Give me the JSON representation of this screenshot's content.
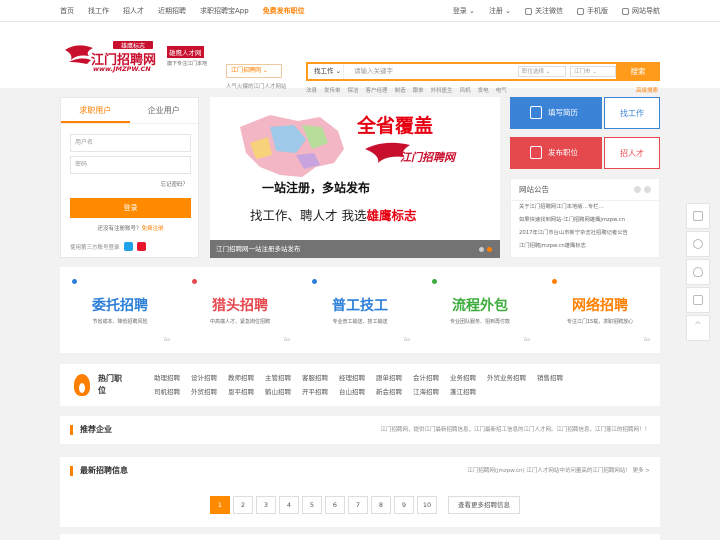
{
  "topnav": {
    "items": [
      "首页",
      "找工作",
      "招人才",
      "近期招聘",
      "求职招聘宝App"
    ],
    "highlight": "免费发布职位",
    "login": "登录 ⌄",
    "register": "注册 ⌄",
    "wechat": "关注微信",
    "mobile": "手机版",
    "sitenav": "网站导航"
  },
  "logo": {
    "main": "江门招聘网",
    "tag": "雄鹰标志",
    "url": "www.JMZPW.CN",
    "partner": "雄鹰人才网",
    "partner_sub": "旗下专注江门本地"
  },
  "city": {
    "name": "江门招聘网 ⌄",
    "sub": "人气火爆的江门人才网站"
  },
  "search": {
    "category": "找工作 ⌄",
    "placeholder": "请输入关键字",
    "select1": "职位选择 ⌄",
    "select2": "江门市 ⌄",
    "button": "搜索",
    "advanced": "高级搜索",
    "hot": [
      "法县",
      "发传单",
      "保洁",
      "客户经理",
      "制造",
      "跟单",
      "外科医生",
      "风机",
      "发电",
      "电气"
    ]
  },
  "login": {
    "tab_jobseeker": "求职用户",
    "tab_employer": "企业用户",
    "username_placeholder": "用户名",
    "password_placeholder": "密码",
    "forgot": "忘记密码？",
    "button": "登录",
    "register_text": "还没有注册账号？",
    "register_link": "免费注册",
    "third_party": "使用第三方账号登录"
  },
  "banner": {
    "title": "全省覆盖",
    "line1": "一站注册，多站发布",
    "line2_prefix": "找工作、聘人才 我选",
    "line2_brand": "雄鹰标志",
    "brand": "江门招聘网",
    "caption": "江门招聘网一站注册多站发布"
  },
  "quick": {
    "resume": "填写简历",
    "find_job": "找工作",
    "post_job": "发布职位",
    "hire": "招人才"
  },
  "notice": {
    "title": "网站公告",
    "items": [
      "关于江门招聘网江门本地版…专栏…",
      "如果快速找到网站-江门招聘网雄鹰jmzpw.cn",
      "2017年江门市台山市新宁杂志社招聘记者公告",
      "江门招聘jmzpw.cn雄鹰标志"
    ]
  },
  "services": [
    {
      "title": "委托招聘",
      "sub": "节省成本、降低招聘风险",
      "go": "Go",
      "color": "#2c7fd8"
    },
    {
      "title": "猎头招聘",
      "sub": "中高端人才、紧急岗位招聘",
      "go": "Go",
      "color": "#e5484d"
    },
    {
      "title": "普工技工",
      "sub": "专业普工输送、技工输送",
      "go": "Go",
      "color": "#2c7fd8"
    },
    {
      "title": "流程外包",
      "sub": "专业团队服务、招到再付款",
      "go": "Go",
      "color": "#3cab3c"
    },
    {
      "title": "网络招聘",
      "sub": "专注江门15载，求职招聘放心",
      "go": "Go",
      "color": "#ff7f00"
    }
  ],
  "hotjobs": {
    "title": "热门职位",
    "items": [
      "助理招聘",
      "设计招聘",
      "教师招聘",
      "主管招聘",
      "客服招聘",
      "经理招聘",
      "跟单招聘",
      "会计招聘",
      "业务招聘",
      "外贸业务招聘",
      "销售招聘",
      "司机招聘",
      "外贸招聘",
      "恩平招聘",
      "鹤山招聘",
      "开平招聘",
      "台山招聘",
      "新会招聘",
      "江海招聘",
      "蓬江招聘"
    ]
  },
  "recommend": {
    "title": "推荐企业",
    "desc": "江门招聘网，提供江门最新招聘信息，江门最新招工信息的江门人才网。江门招聘信息，江门蓬江的招聘网！！"
  },
  "latest": {
    "title": "最新招聘信息",
    "desc": "江门招聘网(jmzpw.cn) 江门人才网站中访问量高的江门招聘网站！ 更多 >",
    "pages": [
      "1",
      "2",
      "3",
      "4",
      "5",
      "6",
      "7",
      "8",
      "9",
      "10"
    ],
    "more": "查看更多招聘信息"
  },
  "colors": {
    "accent": "#ff8a00",
    "blue": "#3b83d7",
    "red": "#e5484d"
  },
  "float_icons": [
    "qrcode-icon",
    "phone-icon",
    "qq-icon",
    "feedback-icon",
    "top-icon"
  ],
  "float_top_label": "^"
}
